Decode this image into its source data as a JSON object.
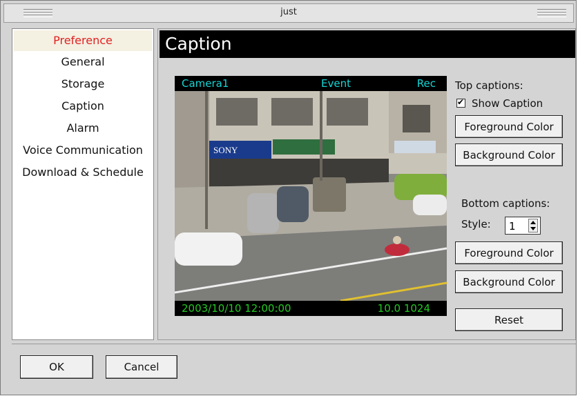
{
  "window": {
    "title": "just"
  },
  "sidebar": {
    "items": [
      {
        "label": "Preference"
      },
      {
        "label": "General"
      },
      {
        "label": "Storage"
      },
      {
        "label": "Caption"
      },
      {
        "label": "Alarm"
      },
      {
        "label": "Voice Communication"
      },
      {
        "label": "Download & Schedule"
      }
    ]
  },
  "panel": {
    "title": "Caption",
    "preview": {
      "top_left": "Camera1",
      "top_center": "Event",
      "top_right": "Rec",
      "bottom_left": "2003/10/10 12:00:00",
      "bottom_right": "10.0 1024"
    },
    "top_captions": {
      "label": "Top captions:",
      "show_caption_label": "Show Caption",
      "show_caption_checked": true,
      "foreground_label": "Foreground Color",
      "background_label": "Background Color"
    },
    "bottom_captions": {
      "label": "Bottom captions:",
      "style_label": "Style:",
      "style_value": "1",
      "foreground_label": "Foreground Color",
      "background_label": "Background Color"
    },
    "reset_label": "Reset"
  },
  "footer": {
    "ok_label": "OK",
    "cancel_label": "Cancel"
  },
  "colors": {
    "selected_text": "#e02020",
    "caption_top": "#15d5d5",
    "caption_bottom": "#22c822"
  }
}
